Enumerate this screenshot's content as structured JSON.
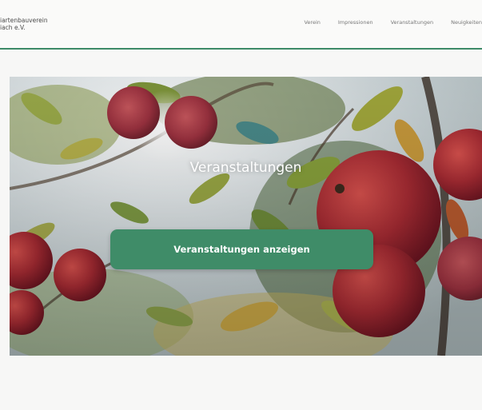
{
  "header": {
    "logo_line1": "iartenbauverein",
    "logo_line2": "iach e.V.",
    "nav": [
      "Verein",
      "Impressionen",
      "Veranstaltungen",
      "Neuigkeiten"
    ]
  },
  "hero": {
    "title": "Veranstaltungen",
    "button_label": "Veranstaltungen anzeigen"
  },
  "colors": {
    "accent": "#3f8c68",
    "header_rule": "#3d8a68"
  }
}
